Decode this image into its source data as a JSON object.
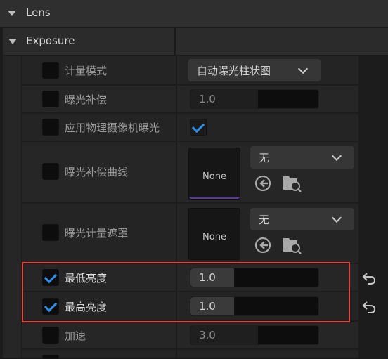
{
  "sections": {
    "lens": {
      "label": "Lens"
    },
    "exposure": {
      "label": "Exposure"
    }
  },
  "properties": [
    {
      "label": "计量模式",
      "checked": false
    },
    {
      "label": "曝光补偿",
      "checked": false
    },
    {
      "label": "应用物理摄像机曝光",
      "checked": false
    },
    {
      "label": "曝光补偿曲线",
      "checked": false
    },
    {
      "label": "曝光计量遮罩",
      "checked": false
    },
    {
      "label": "最低亮度",
      "checked": true
    },
    {
      "label": "最高亮度",
      "checked": true
    },
    {
      "label": "加速",
      "checked": false
    }
  ],
  "values": {
    "metering_mode": "自动曝光柱状图",
    "exposure_comp": "1.0",
    "min_brightness": "1.0",
    "max_brightness": "1.0",
    "speed_up": "3.0",
    "curve_asset": "无",
    "curve_thumb": "None",
    "mask_asset": "无",
    "mask_thumb": "None"
  },
  "colors": {
    "highlight_border": "#e0443c",
    "checkmark": "#2f8fe8",
    "thumb_bar": "#5a3d8a"
  },
  "icons": [
    "expand-triangle-icon",
    "chevron-down-icon",
    "checkmark-icon",
    "browse-asset-icon",
    "find-in-content-browser-icon",
    "reset-to-default-icon"
  ]
}
